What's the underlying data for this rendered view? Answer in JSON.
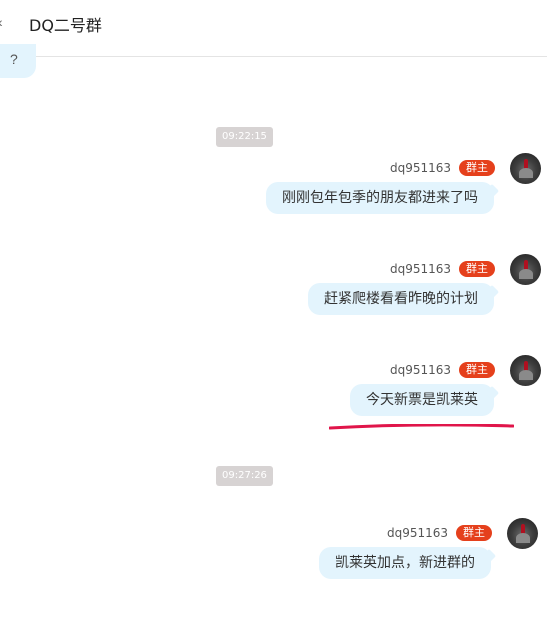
{
  "header": {
    "back_icon": "back-arrow-icon",
    "title": "DQ二号群"
  },
  "previous_message": {
    "text": "?"
  },
  "time_markers": [
    "09:22:15",
    "09:27:26"
  ],
  "messages": [
    {
      "sender": "dq951163",
      "badge": "群主",
      "text": "刚刚包年包季的朋友都进来了吗"
    },
    {
      "sender": "dq951163",
      "badge": "群主",
      "text": "赶紧爬楼看看昨晚的计划"
    },
    {
      "sender": "dq951163",
      "badge": "群主",
      "text": "今天新票是凯莱英"
    },
    {
      "sender": "dq951163",
      "badge": "群主",
      "text": "凯莱英加点，新进群的"
    }
  ],
  "colors": {
    "bubble": "#e3f4fd",
    "badge": "#e5401c",
    "time_pill": "#d7d3d3",
    "annotation_underline": "#e0154a"
  }
}
